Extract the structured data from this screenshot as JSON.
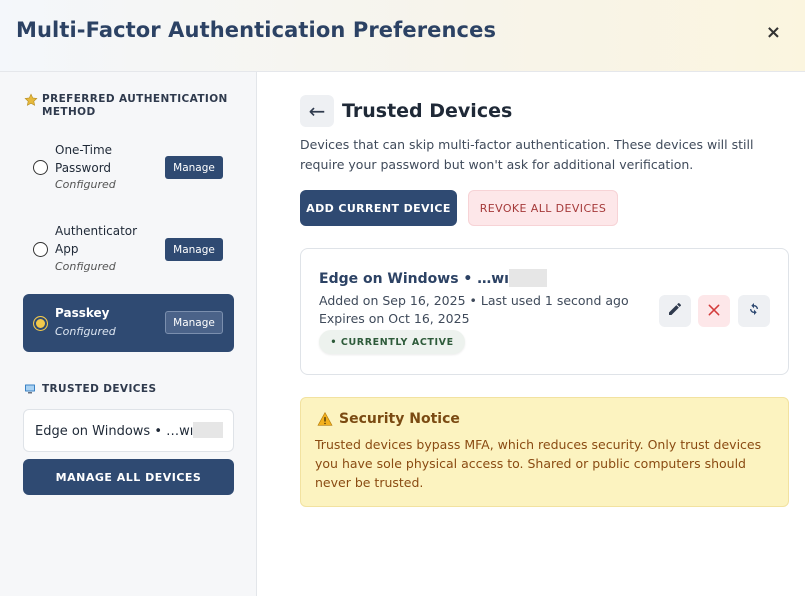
{
  "header": {
    "title": "Multi-Factor Authentication Preferences",
    "close_label": "×"
  },
  "sidebar": {
    "preferred_heading": "PREFERRED AUTHENTICATION METHOD",
    "methods": [
      {
        "name": "One-Time Password",
        "status": "Configured",
        "button": "Manage",
        "selected": false
      },
      {
        "name": "Authenticator App",
        "status": "Configured",
        "button": "Manage",
        "selected": false
      },
      {
        "name": "Passkey",
        "status": "Configured",
        "button": "Manage",
        "selected": true
      }
    ],
    "trusted_heading": "TRUSTED DEVICES",
    "device_name": "Edge on Windows • …wı",
    "manage_all_label": "MANAGE ALL DEVICES"
  },
  "main": {
    "back_label": "←",
    "title": "Trusted Devices",
    "description": "Devices that can skip multi-factor authentication. These devices will still require your password but won't ask for additional verification.",
    "add_button": "ADD CURRENT DEVICE",
    "revoke_button": "REVOKE ALL DEVICES",
    "device": {
      "name": "Edge on Windows • …wı",
      "added": "Added on Sep 16, 2025 • Last used 1 second ago",
      "expires": "Expires on Oct 16, 2025",
      "badge": "• CURRENTLY ACTIVE"
    },
    "notice": {
      "title": "Security Notice",
      "text": "Trusted devices bypass MFA, which reduces security. Only trust devices you have sole physical access to. Shared or public computers should never be trusted."
    }
  },
  "colors": {
    "primary": "#2f4a72",
    "danger": "#d33b3b",
    "warning_bg": "#fcf3c0",
    "warning_text": "#8a4b12"
  }
}
